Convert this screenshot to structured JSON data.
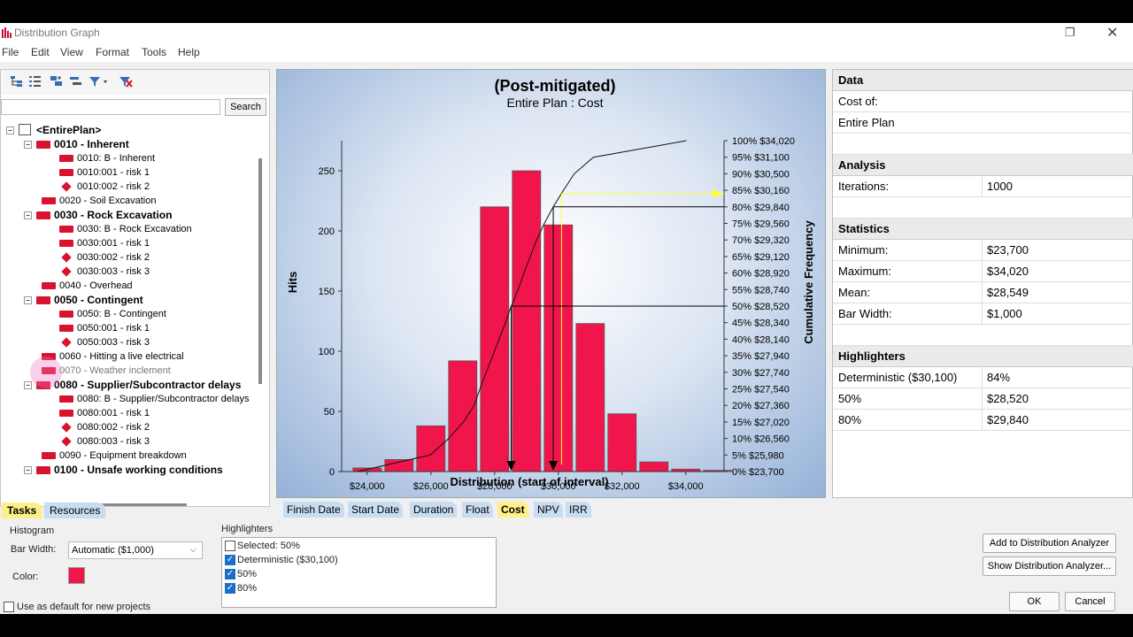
{
  "window": {
    "title": "Distribution Graph"
  },
  "menu": [
    "File",
    "Edit",
    "View",
    "Format",
    "Tools",
    "Help"
  ],
  "search": {
    "value": "",
    "button": "Search"
  },
  "tree": [
    {
      "label": "<EntirePlan>",
      "bold": true
    },
    {
      "label": "0010 - Inherent",
      "bold": true
    },
    {
      "label": "0010: B - Inherent",
      "bold": false
    },
    {
      "label": "0010:001 - risk 1",
      "bold": false
    },
    {
      "label": "0010:002 - risk 2",
      "bold": false
    },
    {
      "label": "0020 - Soil Excavation",
      "bold": false
    },
    {
      "label": "0030 - Rock Excavation",
      "bold": true
    },
    {
      "label": "0030: B - Rock Excavation",
      "bold": false
    },
    {
      "label": "0030:001 - risk 1",
      "bold": false
    },
    {
      "label": "0030:002 - risk 2",
      "bold": false
    },
    {
      "label": "0030:003 - risk 3",
      "bold": false
    },
    {
      "label": "0040 - Overhead",
      "bold": false
    },
    {
      "label": "0050 - Contingent",
      "bold": true
    },
    {
      "label": "0050: B - Contingent",
      "bold": false
    },
    {
      "label": "0050:001 - risk 1",
      "bold": false
    },
    {
      "label": "0050:003 - risk 3",
      "bold": false
    },
    {
      "label": "0060 - Hitting a live electrical",
      "bold": false
    },
    {
      "label": "0070 - Weather inclement",
      "bold": false
    },
    {
      "label": "0080 - Supplier/Subcontractor delays",
      "bold": true
    },
    {
      "label": "0080: B - Supplier/Subcontractor delays",
      "bold": false
    },
    {
      "label": "0080:001 - risk 1",
      "bold": false
    },
    {
      "label": "0080:002 - risk 2",
      "bold": false
    },
    {
      "label": "0080:003 - risk 3",
      "bold": false
    },
    {
      "label": "0090 - Equipment breakdown",
      "bold": false
    },
    {
      "label": "0100 - Unsafe working conditions",
      "bold": true
    }
  ],
  "left_tabs": [
    "Tasks",
    "Resources"
  ],
  "chart_tabs": [
    "Finish Date",
    "Start Date",
    "Duration",
    "Float",
    "Cost",
    "NPV",
    "IRR"
  ],
  "active_chart_tab": "Cost",
  "chart_data": {
    "type": "bar",
    "title": "(Post-mitigated)",
    "subtitle": "Entire Plan : Cost",
    "xlabel": "Distribution (start of interval)",
    "ylabel": "Hits",
    "y2label": "Cumulative Frequency",
    "x_ticks": [
      "$24,000",
      "$26,000",
      "$28,000",
      "$30,000",
      "$32,000",
      "$34,000"
    ],
    "x_tick_values": [
      24000,
      26000,
      28000,
      30000,
      32000,
      34000
    ],
    "y_ticks": [
      0,
      50,
      100,
      150,
      200,
      250
    ],
    "ylim": [
      0,
      275
    ],
    "xlim": [
      23200,
      35200
    ],
    "bins_start": [
      23500,
      24500,
      25500,
      26500,
      27500,
      28500,
      29500,
      30500,
      31500,
      32500,
      33500,
      34500
    ],
    "values": [
      3,
      10,
      38,
      92,
      220,
      250,
      205,
      123,
      48,
      8,
      2,
      1
    ],
    "cumulative_ticks": [
      "100%  $34,020",
      "95%  $31,100",
      "90%  $30,500",
      "85%  $30,160",
      "80%  $29,840",
      "75%  $29,560",
      "70%  $29,320",
      "65%  $29,120",
      "60%  $28,920",
      "55%  $28,740",
      "50%  $28,520",
      "45%  $28,340",
      "40%  $28,140",
      "35%  $27,940",
      "30%  $27,740",
      "25%  $27,540",
      "20%  $27,360",
      "15%  $27,020",
      "10%  $26,560",
      "5%  $25,980",
      "0%  $23,700"
    ],
    "highlighter_marks": [
      {
        "label": "Deterministic ($30,100)",
        "x": 30100,
        "pct": 84,
        "color": "#ffff33"
      },
      {
        "label": "50%",
        "x": 28520,
        "pct": 50,
        "color": "#000000"
      },
      {
        "label": "80%",
        "x": 29840,
        "pct": 80,
        "color": "#000000"
      }
    ],
    "bar_color": "#f0164c",
    "grid": false
  },
  "data_panel": {
    "data_header": "Data",
    "cost_of_label": "Cost of:",
    "cost_of_value": "Entire Plan",
    "analysis_header": "Analysis",
    "iterations_label": "Iterations:",
    "iterations_value": "1000",
    "statistics_header": "Statistics",
    "stats": [
      {
        "k": "Minimum:",
        "v": "$23,700"
      },
      {
        "k": "Maximum:",
        "v": "$34,020"
      },
      {
        "k": "Mean:",
        "v": "$28,549"
      },
      {
        "k": "Bar Width:",
        "v": "$1,000"
      }
    ],
    "highlighters_header": "Highlighters",
    "highlighters": [
      {
        "k": "Deterministic ($30,100)",
        "v": "84%"
      },
      {
        "k": "50%",
        "v": "$28,520"
      },
      {
        "k": "80%",
        "v": "$29,840"
      }
    ]
  },
  "bottom": {
    "histogram_label": "Histogram",
    "bar_width_label": "Bar Width:",
    "bar_width_value": "Automatic ($1,000)",
    "color_label": "Color:",
    "use_default_label": "Use as default for new projects",
    "highlighters_label": "Highlighters",
    "highlighter_items": [
      {
        "label": "Selected: 50%",
        "checked": false
      },
      {
        "label": "Deterministic ($30,100)",
        "checked": true
      },
      {
        "label": "50%",
        "checked": true
      },
      {
        "label": "80%",
        "checked": true
      }
    ],
    "add_button": "Add to Distribution Analyzer",
    "show_button": "Show Distribution Analyzer...",
    "ok_button": "OK",
    "cancel_button": "Cancel"
  }
}
